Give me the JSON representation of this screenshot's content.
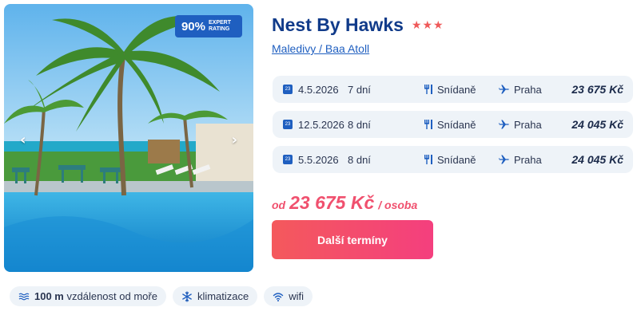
{
  "hotel": {
    "name": "Nest By Hawks",
    "stars": 3,
    "star_glyph": "★",
    "location": "Maledivy / Baa Atoll"
  },
  "badge": {
    "percent": "90%",
    "text": "Expert rating"
  },
  "gallery": {
    "prev": "‹",
    "next": "›"
  },
  "terms": [
    {
      "date": "4.5.2026",
      "days": "7 dní",
      "meal": "Snídaně",
      "city": "Praha",
      "price": "23 675 Kč",
      "cal": "23"
    },
    {
      "date": "12.5.2026",
      "days": "8 dní",
      "meal": "Snídaně",
      "city": "Praha",
      "price": "24 045 Kč",
      "cal": "23"
    },
    {
      "date": "5.5.2026",
      "days": "8 dní",
      "meal": "Snídaně",
      "city": "Praha",
      "price": "24 045 Kč",
      "cal": "23"
    }
  ],
  "pricing": {
    "from": "od",
    "amount": "23 675 Kč",
    "per": "/ osoba"
  },
  "cta": {
    "label": "Další termíny"
  },
  "amenities": {
    "distance_value": "100 m",
    "distance_text": "vzdálenost od moře",
    "ac": "klimatizace",
    "wifi": "wifi"
  },
  "colors": {
    "brand_blue": "#1f5fc0",
    "title_blue": "#113b8a",
    "accent_pink": "#f0506e",
    "row_bg": "#eef3f8"
  }
}
